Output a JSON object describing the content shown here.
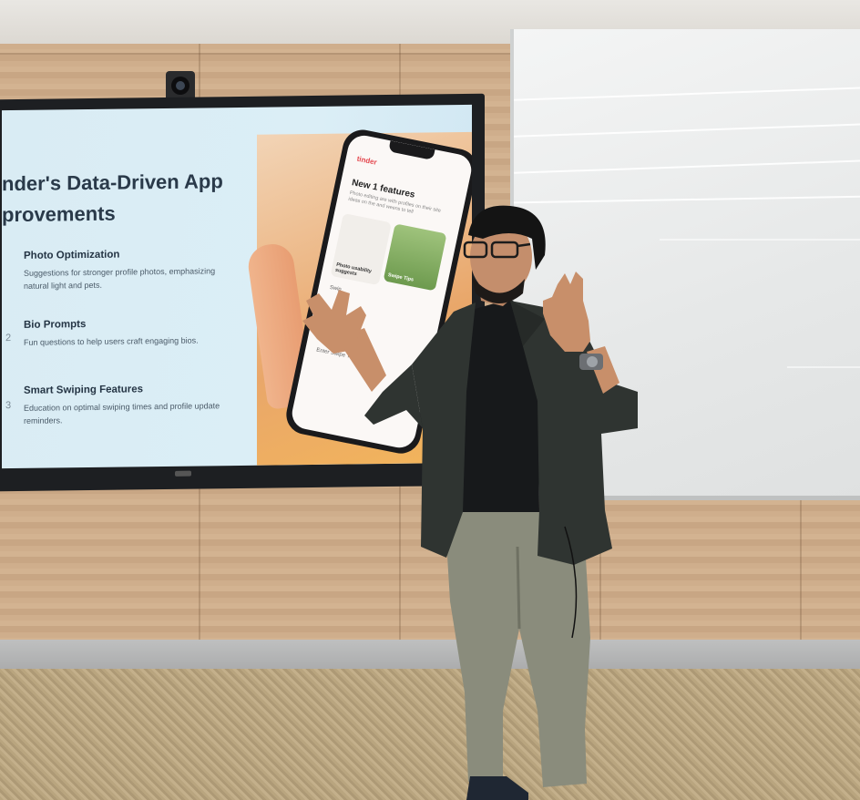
{
  "slide": {
    "title_line1": "nder's Data-Driven App",
    "title_line2": "provements",
    "items": [
      {
        "num": "",
        "heading": "Photo Optimization",
        "desc": "Suggestions for stronger profile photos, emphasizing natural light and pets."
      },
      {
        "num": "2",
        "heading": "Bio Prompts",
        "desc": "Fun questions to help users craft engaging bios."
      },
      {
        "num": "3",
        "heading": "Smart Swiping Features",
        "desc": "Education on optimal swiping times and profile update reminders."
      }
    ]
  },
  "phone": {
    "app_name": "tinder",
    "title": "New 1 features",
    "subtitle": "Photo editing are with profiles on their site ideas on the and weens to tell",
    "card_label": "Photo usability suggests",
    "photo_label": "Swipe Tips",
    "swipe_label": "Swip",
    "bottom_label": "Enter Swipe Tips"
  },
  "colors": {
    "screen_bg": "#d9ecf4",
    "slide_text": "#2a3a4a",
    "blazer": "#2f3431",
    "trousers": "#8a8c7c",
    "wood": "#cfae8c"
  }
}
